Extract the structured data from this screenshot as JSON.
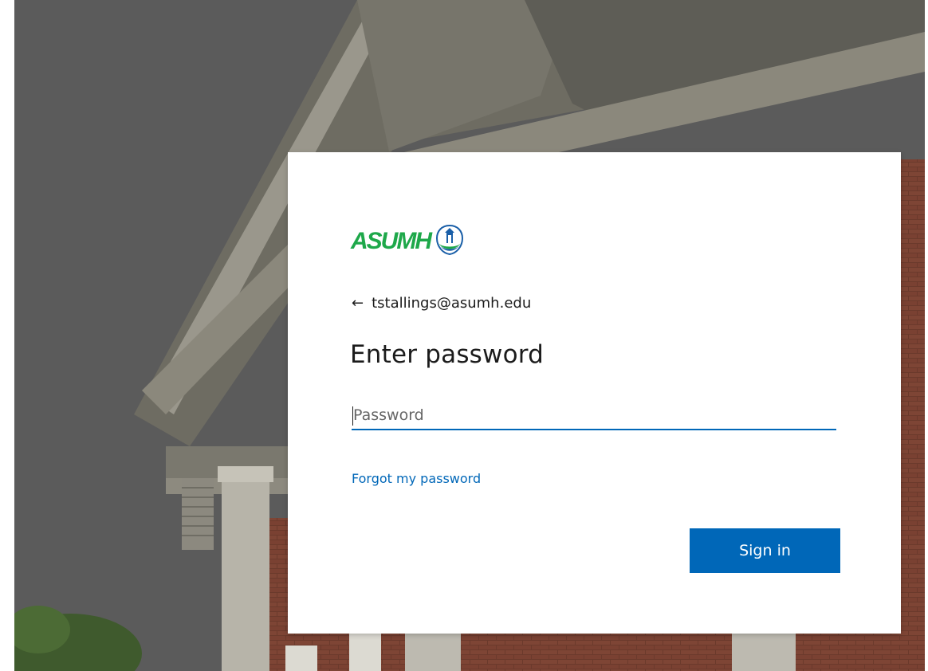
{
  "brand": {
    "logo_text": "ASUMH",
    "logo_color": "#1ea84a",
    "seal_icon": "university-seal-icon"
  },
  "signin": {
    "identity": {
      "back_icon": "arrow-left-icon",
      "email": "tstallings@asumh.edu"
    },
    "title": "Enter password",
    "password_field": {
      "placeholder": "Password",
      "value": ""
    },
    "forgot_link": "Forgot my password",
    "submit_label": "Sign in"
  },
  "colors": {
    "accent": "#0067b8",
    "card_background": "#ffffff",
    "text": "#1b1b1b"
  }
}
